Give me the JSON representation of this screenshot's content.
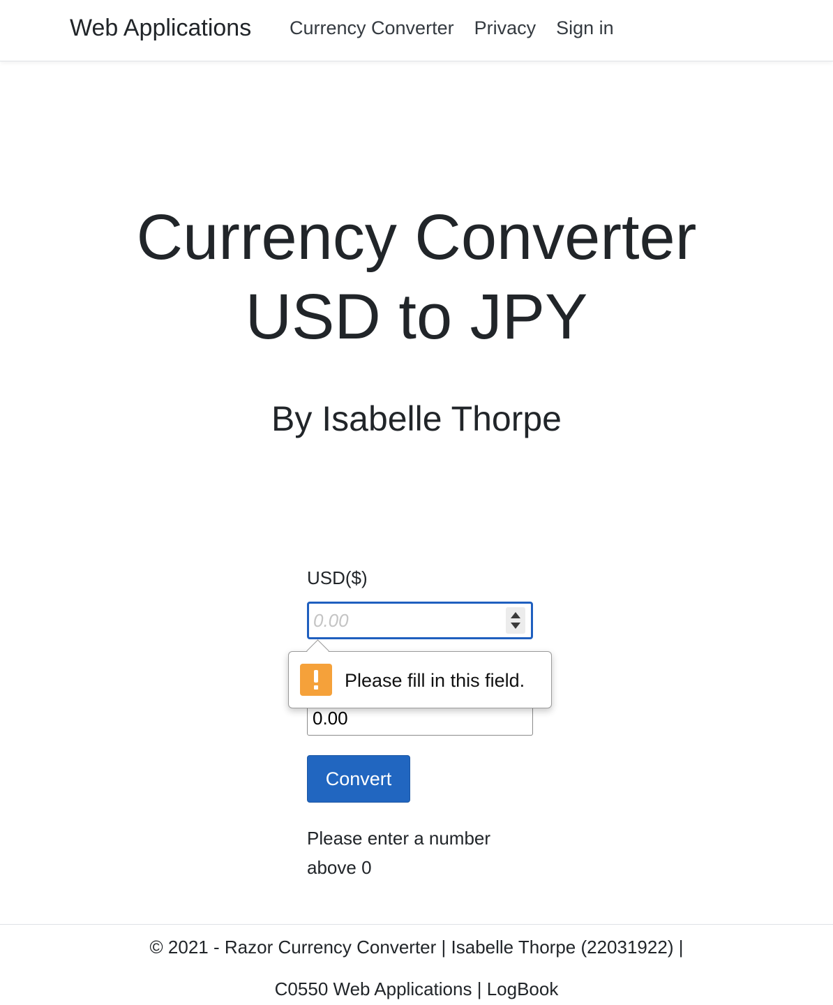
{
  "navbar": {
    "brand": "Web Applications",
    "links": [
      "Currency Converter",
      "Privacy",
      "Sign in"
    ]
  },
  "hero": {
    "title_line1": "Currency Converter",
    "title_line2": "USD to JPY",
    "author": "By Isabelle Thorpe"
  },
  "form": {
    "usd_label": "USD($)",
    "usd_placeholder": "0.00",
    "usd_value": "",
    "output_value": "0.00",
    "convert_label": "Convert",
    "message": "Please enter a number above 0"
  },
  "validation_tooltip": {
    "text": "Please fill in this field.",
    "icon": "warning-icon",
    "color": "#f5a13a"
  },
  "footer": {
    "line1_prefix": "© 2021 - Razor Currency Converter | Isabelle Thorpe (22031922) |",
    "line2_course": "C0550 Web Applications |",
    "line2_link": "LogBook"
  },
  "colors": {
    "primary": "#2166c0",
    "focus_border": "#1f5fbf",
    "text": "#212529"
  }
}
